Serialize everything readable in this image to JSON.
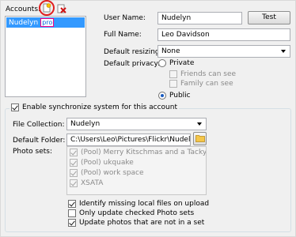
{
  "accounts": {
    "label": "Accounts:",
    "items": [
      {
        "name": "Nudelyn",
        "badge": "pro",
        "selected": true
      }
    ]
  },
  "account_form": {
    "user_name_label": "User Name:",
    "user_name_value": "Nudelyn",
    "test_button": "Test",
    "full_name_label": "Full Name:",
    "full_name_value": "Leo Davidson",
    "default_resizing_label": "Default resizing:",
    "default_resizing_value": "None",
    "default_privacy_label": "Default privacy:",
    "privacy_private": "Private",
    "friends_can_see": "Friends can see",
    "family_can_see": "Family can see",
    "privacy_public": "Public"
  },
  "sync": {
    "enable_label": "Enable synchronize system for this account",
    "file_collection_label": "File Collection:",
    "file_collection_value": "Nudelyn",
    "default_folder_label": "Default Folder:",
    "default_folder_value": "C:\\Users\\Leo\\Pictures\\Flickr\\Nudelyn",
    "photo_sets_label": "Photo sets:",
    "photo_sets": [
      "(Pool) Merry Kitschmas and a Tacky New Ye",
      "(Pool) ukquake",
      "(Pool) work space",
      "XSATA"
    ],
    "identify_missing": "Identify missing local files on upload",
    "only_update_checked": "Only update checked Photo sets",
    "update_not_in_set": "Update photos that are not in a set"
  },
  "colors": {
    "selection": "#3399ff",
    "highlight_circle": "#e02020",
    "badge_bg": "#ff0084"
  },
  "icons": {
    "new_account": "new-document-icon",
    "delete_account": "delete-icon",
    "browse_folder": "folder-icon"
  }
}
